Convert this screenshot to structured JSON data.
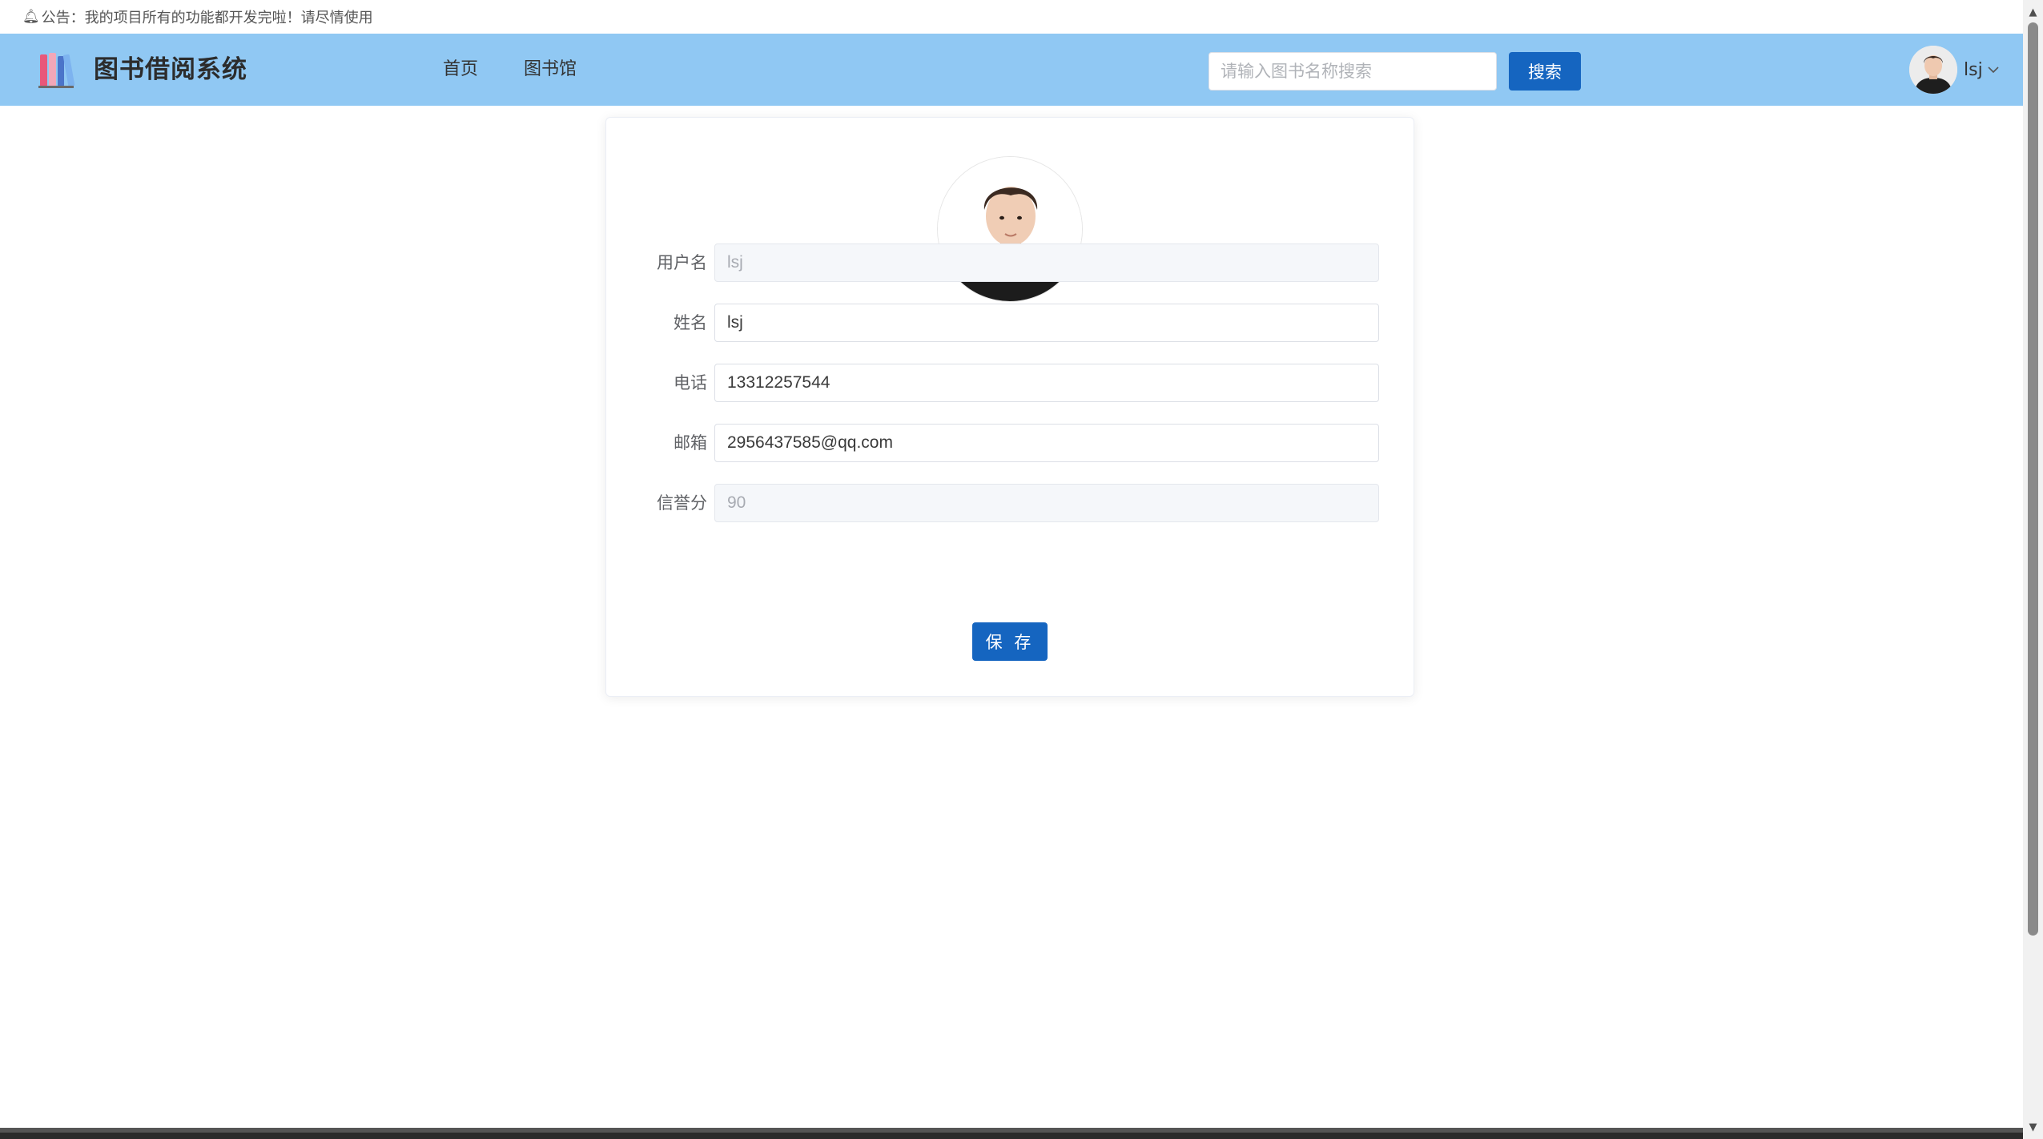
{
  "notice": {
    "icon": "bell-icon",
    "text": "公告：我的项目所有的功能都开发完啦！请尽情使用"
  },
  "header": {
    "background": "#90c8f3",
    "logo_icon": "books-icon",
    "brand": "图书借阅系统",
    "nav": [
      {
        "label": "首页"
      },
      {
        "label": "图书馆"
      }
    ],
    "search": {
      "placeholder": "请输入图书名称搜索",
      "value": "",
      "button_label": "搜索"
    },
    "user": {
      "name": "lsj",
      "avatar_icon": "user-avatar",
      "dropdown_icon": "chevron-down-icon"
    }
  },
  "profile": {
    "photo": "profile-photo",
    "fields": [
      {
        "label": "用户名",
        "value": "lsj",
        "disabled": true
      },
      {
        "label": "姓名",
        "value": "lsj",
        "disabled": false
      },
      {
        "label": "电话",
        "value": "13312257544",
        "disabled": false
      },
      {
        "label": "邮箱",
        "value": "2956437585@qq.com",
        "disabled": false
      },
      {
        "label": "信誉分",
        "value": "90",
        "disabled": true
      }
    ],
    "save_label": "保 存"
  },
  "colors": {
    "primary": "#1565c0",
    "header": "#90c8f3"
  }
}
